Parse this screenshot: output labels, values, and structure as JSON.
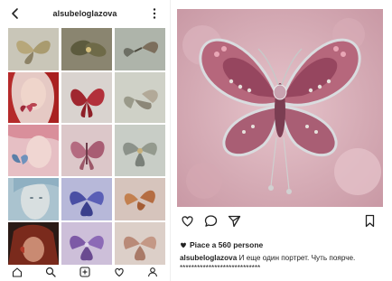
{
  "left": {
    "header": {
      "username": "alsubeloglazova"
    },
    "grid": {
      "tiles": [
        {
          "name": "tile-1"
        },
        {
          "name": "tile-2"
        },
        {
          "name": "tile-3"
        },
        {
          "name": "tile-4"
        },
        {
          "name": "tile-5"
        },
        {
          "name": "tile-6"
        },
        {
          "name": "tile-7"
        },
        {
          "name": "tile-8"
        },
        {
          "name": "tile-9"
        },
        {
          "name": "tile-10"
        },
        {
          "name": "tile-11"
        },
        {
          "name": "tile-12"
        },
        {
          "name": "tile-13"
        },
        {
          "name": "tile-14"
        },
        {
          "name": "tile-15"
        }
      ]
    },
    "bottom_nav": [
      "home-icon",
      "search-icon",
      "add-post-icon",
      "heart-icon",
      "profile-icon"
    ]
  },
  "right": {
    "likes": {
      "text": "Piace a 560 persone"
    },
    "caption": {
      "username": "alsubeloglazova",
      "text": "И еще один портрет.  Чуть поярче. ****************************"
    },
    "actions": [
      "heart-icon",
      "comment-icon",
      "share-icon",
      "bookmark-icon"
    ]
  },
  "colors": {
    "text": "#222222",
    "butterfly_pink": "#b86c80",
    "background_pink": "#d8a9b3"
  }
}
